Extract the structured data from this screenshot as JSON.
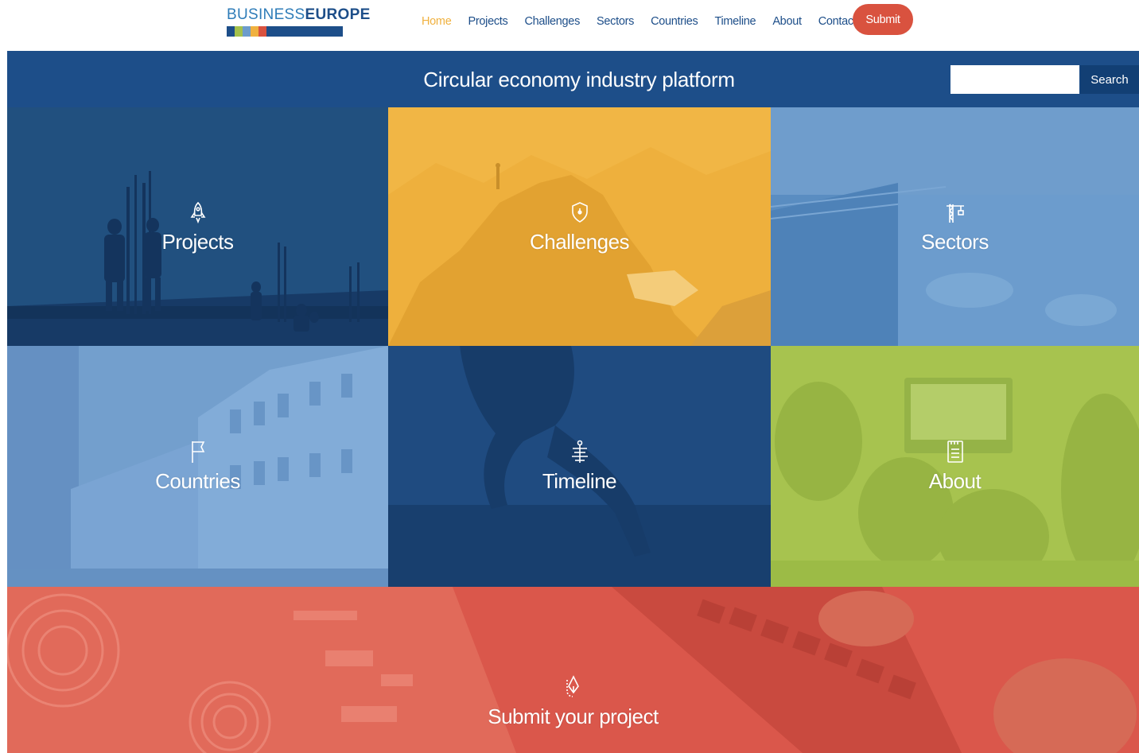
{
  "header": {
    "logo": {
      "part1": "BUSINESS",
      "part2": "EUROPE"
    },
    "nav": [
      {
        "label": "Home",
        "active": true
      },
      {
        "label": "Projects"
      },
      {
        "label": "Challenges"
      },
      {
        "label": "Sectors"
      },
      {
        "label": "Countries"
      },
      {
        "label": "Timeline"
      },
      {
        "label": "About"
      },
      {
        "label": "Contact us"
      }
    ],
    "submit_label": "Submit"
  },
  "banner": {
    "title": "Circular economy industry platform",
    "search_placeholder": "",
    "search_button": "Search"
  },
  "tiles": [
    {
      "label": "Projects",
      "icon": "rocket-icon"
    },
    {
      "label": "Challenges",
      "icon": "shield-icon"
    },
    {
      "label": "Sectors",
      "icon": "crane-icon"
    },
    {
      "label": "Countries",
      "icon": "flag-icon"
    },
    {
      "label": "Timeline",
      "icon": "timeline-icon"
    },
    {
      "label": "About",
      "icon": "document-icon"
    }
  ],
  "submit_tile": {
    "label": "Submit your project",
    "icon": "pen-nib-icon"
  },
  "colors": {
    "brand_blue": "#1d4e89",
    "accent_orange": "#f0b13f",
    "submit_red": "#d9523f",
    "tile_projects": "#1f4b80",
    "tile_challenges": "#efb23f",
    "tile_sectors": "#5689be",
    "tile_countries": "#6d9ccc",
    "tile_timeline": "#1f4b80",
    "tile_about": "#a4c14c",
    "tile_submit": "#d9564a"
  }
}
